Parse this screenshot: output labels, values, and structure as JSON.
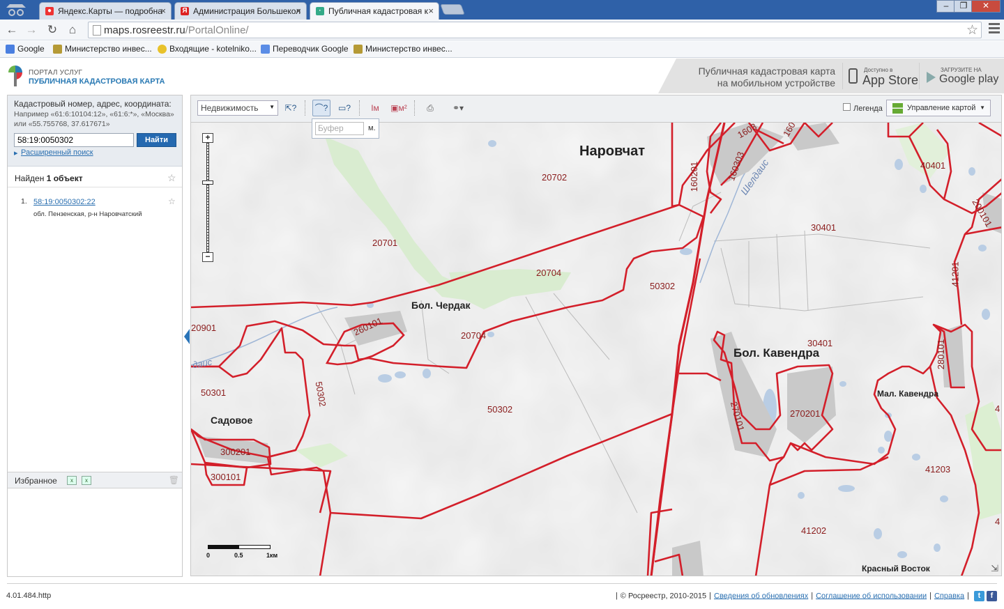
{
  "browser": {
    "tabs": [
      {
        "label": "Яндекс.Карты — подробна",
        "close": "×"
      },
      {
        "label": "Администрация Большекол",
        "close": "×"
      },
      {
        "label": "Публичная кадастровая к",
        "close": "×"
      }
    ],
    "window_buttons": [
      "‒",
      "❐",
      "✕"
    ],
    "url_host": "maps.rosreestr.ru",
    "url_path": "/PortalOnline/",
    "bookmarks": [
      "Google",
      "Министерство инвес...",
      "Входящие - kotelniko...",
      "Переводчик Google",
      "Министерство инвес..."
    ]
  },
  "header": {
    "brand_top": "ПОРТАЛ УСЛУГ",
    "brand_main": "ПУБЛИЧНАЯ КАДАСТРОВАЯ КАРТА",
    "mobile_line1": "Публичная кадастровая карта",
    "mobile_line2": "на мобильном устройстве",
    "appstore_small": "Доступно в",
    "appstore_big": "App Store",
    "gplay_small": "ЗАГРУЗИТЕ НА",
    "gplay_big": "Google play"
  },
  "search": {
    "title": "Кадастровый номер, адрес, координата:",
    "hint": "Например «61:6:10104:12», «61:6:*», «Москва» или «55.755768, 37.617671»",
    "value": "58:19:0050302",
    "button": "Найти",
    "advanced": "Расширенный поиск"
  },
  "results": {
    "found_prefix": "Найден",
    "found_count": "1 объект",
    "items": [
      {
        "num": "1.",
        "link": "58:19:0050302:22",
        "address": "обл. Пензенская, р-н Наровчатский"
      }
    ]
  },
  "favorites": {
    "label": "Избранное"
  },
  "map_toolbar": {
    "layer": "Недвижимость",
    "buffer_placeholder": "Буфер",
    "buffer_unit": "м.",
    "legend": "Легенда",
    "map_control": "Управление картой"
  },
  "map": {
    "places": [
      {
        "id": "narovchat",
        "text": "Наровчат"
      },
      {
        "id": "bol-cherdak",
        "text": "Бол. Чердак"
      },
      {
        "id": "bol-kavendra",
        "text": "Бол. Кавендра"
      },
      {
        "id": "mal-kavendra",
        "text": "Мал. Кавендра"
      },
      {
        "id": "sadovoe",
        "text": "Садовое"
      },
      {
        "id": "krasny-vostok",
        "text": "Красный Восток"
      }
    ],
    "river": "Шелдаис",
    "river2": "даис",
    "parcels": [
      "20702",
      "20701",
      "20704",
      "20704",
      "50302",
      "30401",
      "30401",
      "160201",
      "160303",
      "1603",
      "160",
      "40401",
      "200101",
      "41201",
      "280101",
      "260101",
      "20901",
      "50301",
      "50302",
      "50302",
      "270101",
      "270201",
      "300201",
      "300101",
      "41203",
      "41202",
      "4",
      "4"
    ],
    "scale": [
      "0",
      "0.5",
      "1км"
    ]
  },
  "footer": {
    "version": "4.01.484.http",
    "copyright": "© Росреестр, 2010-2015",
    "links": [
      "Сведения об обновлениях",
      "Соглашение об использовании",
      "Справка"
    ]
  }
}
